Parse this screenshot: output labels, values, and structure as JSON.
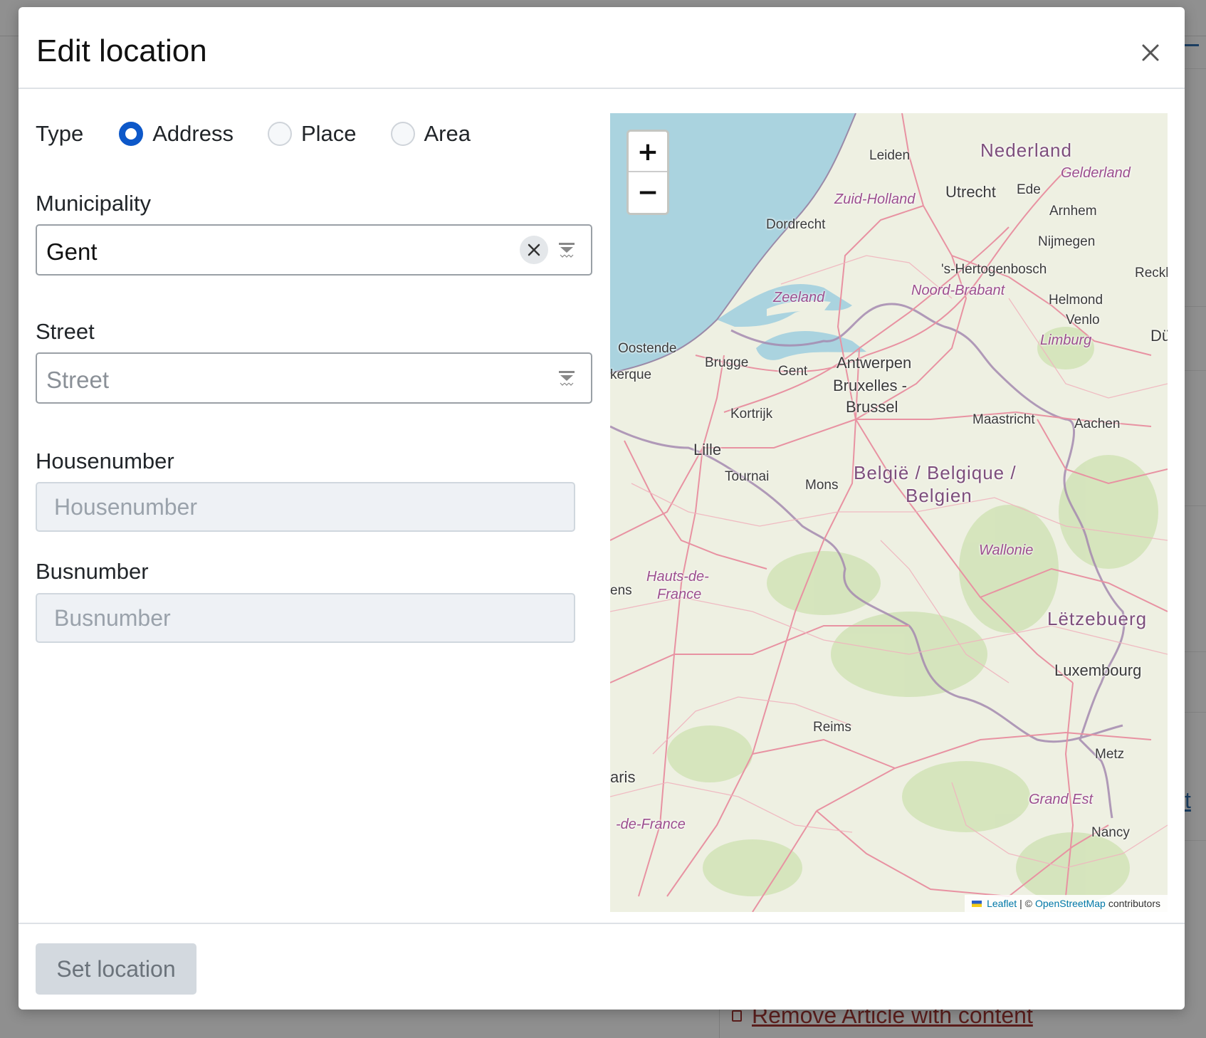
{
  "modal": {
    "title": "Edit location",
    "close_icon": "close-icon"
  },
  "type": {
    "label": "Type",
    "options": [
      "Address",
      "Place",
      "Area"
    ],
    "selected": "Address"
  },
  "municipality": {
    "label": "Municipality",
    "value": "Gent"
  },
  "street": {
    "label": "Street",
    "placeholder": "Street"
  },
  "housenumber": {
    "label": "Housenumber",
    "placeholder": "Housenumber"
  },
  "busnumber": {
    "label": "Busnumber",
    "placeholder": "Busnumber"
  },
  "map": {
    "zoom_in": "+",
    "zoom_out": "−",
    "attribution": {
      "leaflet": "Leaflet",
      "separator": "| ©",
      "osm": "OpenStreetMap",
      "suffix": "contributors"
    },
    "labels": {
      "nederland": "Nederland",
      "gelderland": "Gelderland",
      "leiden": "Leiden",
      "utrecht": "Utrecht",
      "ede": "Ede",
      "zuid_holland": "Zuid-Holland",
      "arnhem": "Arnhem",
      "dordrecht": "Dordrecht",
      "nijmegen": "Nijmegen",
      "hertogenbosch": "'s-Hertogenbosch",
      "reckl": "Reckl",
      "noord_brabant": "Noord-Brabant",
      "zeeland": "Zeeland",
      "helmond": "Helmond",
      "venlo": "Venlo",
      "limburg": "Limburg",
      "du": "Dü",
      "oostende": "Oostende",
      "brugge": "Brugge",
      "gent": "Gent",
      "antwerpen": "Antwerpen",
      "kerque": "kerque",
      "bruxelles": "Bruxelles -",
      "brussel": "Brussel",
      "kortrijk": "Kortrijk",
      "maastricht": "Maastricht",
      "aachen": "Aachen",
      "lille": "Lille",
      "tournai": "Tournai",
      "mons": "Mons",
      "belgie": "België / Belgique /",
      "belgien": "Belgien",
      "wallonie": "Wallonie",
      "hauts": "Hauts-de-",
      "france": "France",
      "ens": "ens",
      "letzebuerg": "Lëtzebuerg",
      "luxembourg": "Luxembourg",
      "reims": "Reims",
      "metz": "Metz",
      "aris": "aris",
      "grand_est": "Grand Est",
      "de_france": "-de-France",
      "nancy": "Nancy"
    }
  },
  "footer": {
    "set_location": "Set location"
  },
  "background": {
    "remove_link": "Remove Article with content",
    "link_fragment": "t"
  },
  "colors": {
    "radio_checked": "#0d58c9",
    "map_water": "#aad3df",
    "map_land": "#eef0e2",
    "disabled_button": "#d3d9df",
    "danger_link": "#5b1e1c"
  }
}
